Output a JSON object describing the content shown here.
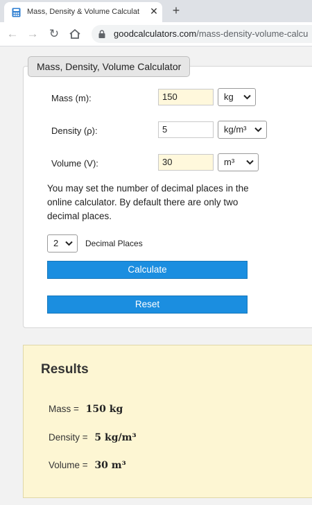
{
  "browser": {
    "tab_title": "Mass, Density & Volume Calculat",
    "new_tab_symbol": "+",
    "close_symbol": "✕",
    "url_domain": "goodcalculators.com",
    "url_path": "/mass-density-volume-calcu"
  },
  "calculator": {
    "title": "Mass, Density, Volume Calculator",
    "fields": [
      {
        "label": "Mass (m):",
        "value": "150",
        "unit": "kg"
      },
      {
        "label": "Density (ρ):",
        "value": "5",
        "unit": "kg/m³"
      },
      {
        "label": "Volume (V):",
        "value": "30",
        "unit": "m³"
      }
    ],
    "info_text": "You may set the number of decimal places in the online calculator. By default there are only two decimal places.",
    "decimal_places_value": "2",
    "decimal_places_label": "Decimal Places",
    "calculate_label": "Calculate",
    "reset_label": "Reset"
  },
  "results": {
    "title": "Results",
    "lines": [
      {
        "label": "Mass =",
        "value": "150 kg"
      },
      {
        "label": "Density =",
        "value": "5 kg/m³"
      },
      {
        "label": "Volume =",
        "value": "30 m³"
      }
    ]
  },
  "colors": {
    "button_blue": "#1b8ee0",
    "input_highlight": "#fff8dc",
    "results_background": "#fdf6d3"
  }
}
